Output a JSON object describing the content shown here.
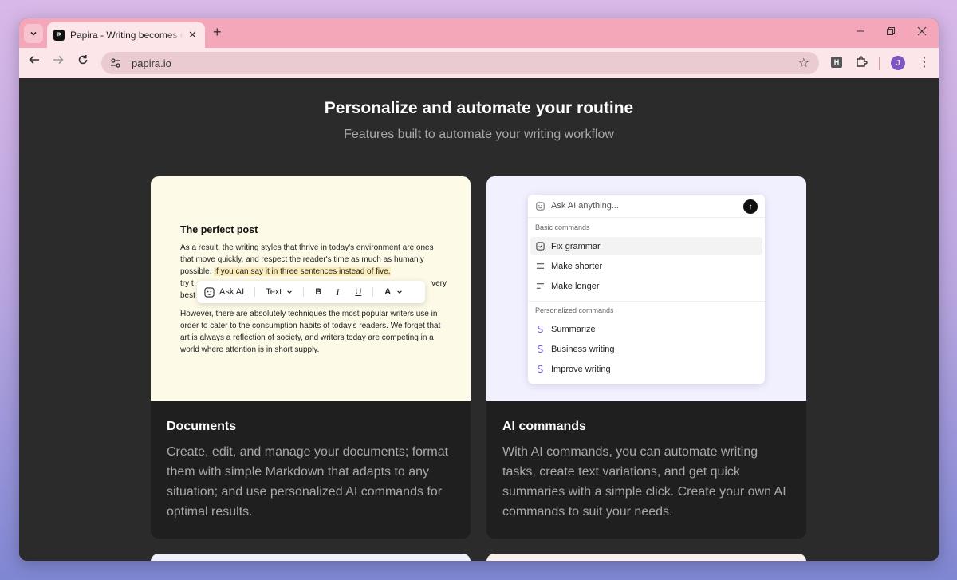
{
  "browser": {
    "tab_title": "Papira - Writing becomes easy with",
    "favicon_letter": "P.",
    "url": "papira.io",
    "ext_badge": "H",
    "avatar_letter": "J"
  },
  "hero": {
    "title": "Personalize and automate your routine",
    "subtitle": "Features built to automate your writing workflow"
  },
  "documents_card": {
    "title": "Documents",
    "description": "Create, edit, and manage your documents; format them with simple Markdown that adapts to any situation; and use personalized AI commands for optimal results.",
    "preview": {
      "heading": "The perfect post",
      "p1_a": "As a result, the writing styles that thrive in today's environment are ones that move quickly, and respect the reader's time as much as humanly possible. ",
      "p1_highlight": "If you can say it in three sentences instead of five,",
      "p1_b_left": "try t",
      "p1_b_right": "very",
      "p1_c": "best",
      "p2": "However, there are absolutely techniques the most popular writers use in order to cater to the consumption habits of today's readers. We forget that art is always a reflection of society, and writers today are competing in a world where attention is in short supply.",
      "toolbar": {
        "ask_ai": "Ask AI",
        "text": "Text",
        "bold": "B",
        "italic": "I",
        "underline": "U",
        "color": "A"
      }
    }
  },
  "ai_card": {
    "title": "AI commands",
    "description": "With AI commands, you can automate writing tasks, create text variations, and get quick summaries with a simple click. Create your own AI commands to suit your needs.",
    "menu": {
      "placeholder": "Ask AI anything...",
      "basic_header": "Basic commands",
      "basic": [
        "Fix grammar",
        "Make shorter",
        "Make longer"
      ],
      "personal_header": "Personalized commands",
      "personal": [
        "Summarize",
        "Business writing",
        "Improve writing"
      ]
    }
  },
  "colors": {
    "page_bg": "#2b2b2b",
    "card_bg": "#1f1f1f",
    "doc_bg": "#fefae8",
    "ai_bg": "#f1f0ff",
    "highlight": "#fbecb9",
    "tab_strip": "#f4a7b9"
  }
}
